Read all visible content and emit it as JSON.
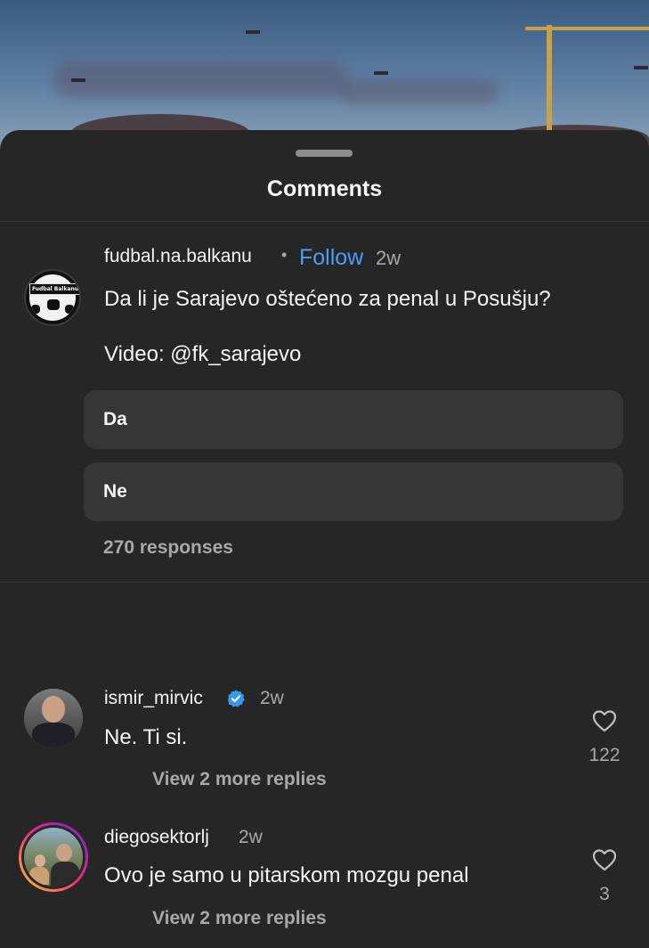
{
  "sheet": {
    "title": "Comments"
  },
  "post": {
    "username": "fudbal.na.balkanu",
    "separator": "•",
    "follow_label": "Follow",
    "time": "2w",
    "text": "Da li je Sarajevo oštećeno za penal u Posušju?",
    "video_credit": "Video: @fk_sarajevo",
    "avatar_text": "Fudbal Balkanu",
    "poll": {
      "options": [
        "Da",
        "Ne"
      ],
      "responses": "270 responses"
    }
  },
  "comments": [
    {
      "username": "ismir_mirvic",
      "verified": true,
      "time": "2w",
      "text": "Ne. Ti si.",
      "likes": "122",
      "replies_label": "View 2 more replies"
    },
    {
      "username": "diegosektorlj",
      "verified": false,
      "time": "2w",
      "text": "Ovo je samo u pitarskom mozgu penal",
      "likes": "3",
      "replies_label": "View 2 more replies"
    }
  ],
  "colors": {
    "background": "#262626",
    "link": "#4a9ff5",
    "secondary_text": "#a8a8a8",
    "poll_option": "#363636",
    "verified": "#3897f0"
  },
  "icons": {
    "like": "heart-icon",
    "verified": "verified-badge-icon"
  }
}
